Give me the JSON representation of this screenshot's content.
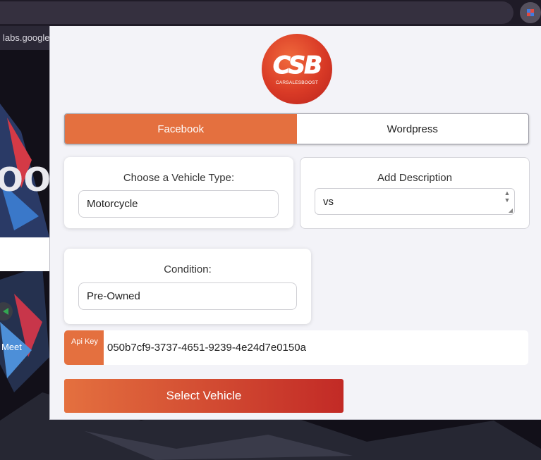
{
  "browser": {
    "url_fragment": "labs.google/",
    "extension_icon": "puzzle-extension-icon"
  },
  "background_page": {
    "partial_text": "oo",
    "meet_label": "Meet"
  },
  "popup": {
    "logo": {
      "mark": "CSB",
      "wordmark": "CARSALESBOOST"
    },
    "tabs": [
      {
        "label": "Facebook",
        "active": true
      },
      {
        "label": "Wordpress",
        "active": false
      }
    ],
    "vehicle_type": {
      "label": "Choose a Vehicle Type:",
      "value": "Motorcycle"
    },
    "description": {
      "label": "Add Description",
      "value": "vs"
    },
    "condition": {
      "label": "Condition:",
      "value": "Pre-Owned"
    },
    "api_key": {
      "badge": "Api Key",
      "value": "050b7cf9-3737-4651-9239-4e24d7e0150a"
    },
    "submit_label": "Select Vehicle",
    "colors": {
      "accent": "#e4703f",
      "accent_dark": "#c22a26",
      "panel_bg": "#f3f3f8"
    }
  }
}
